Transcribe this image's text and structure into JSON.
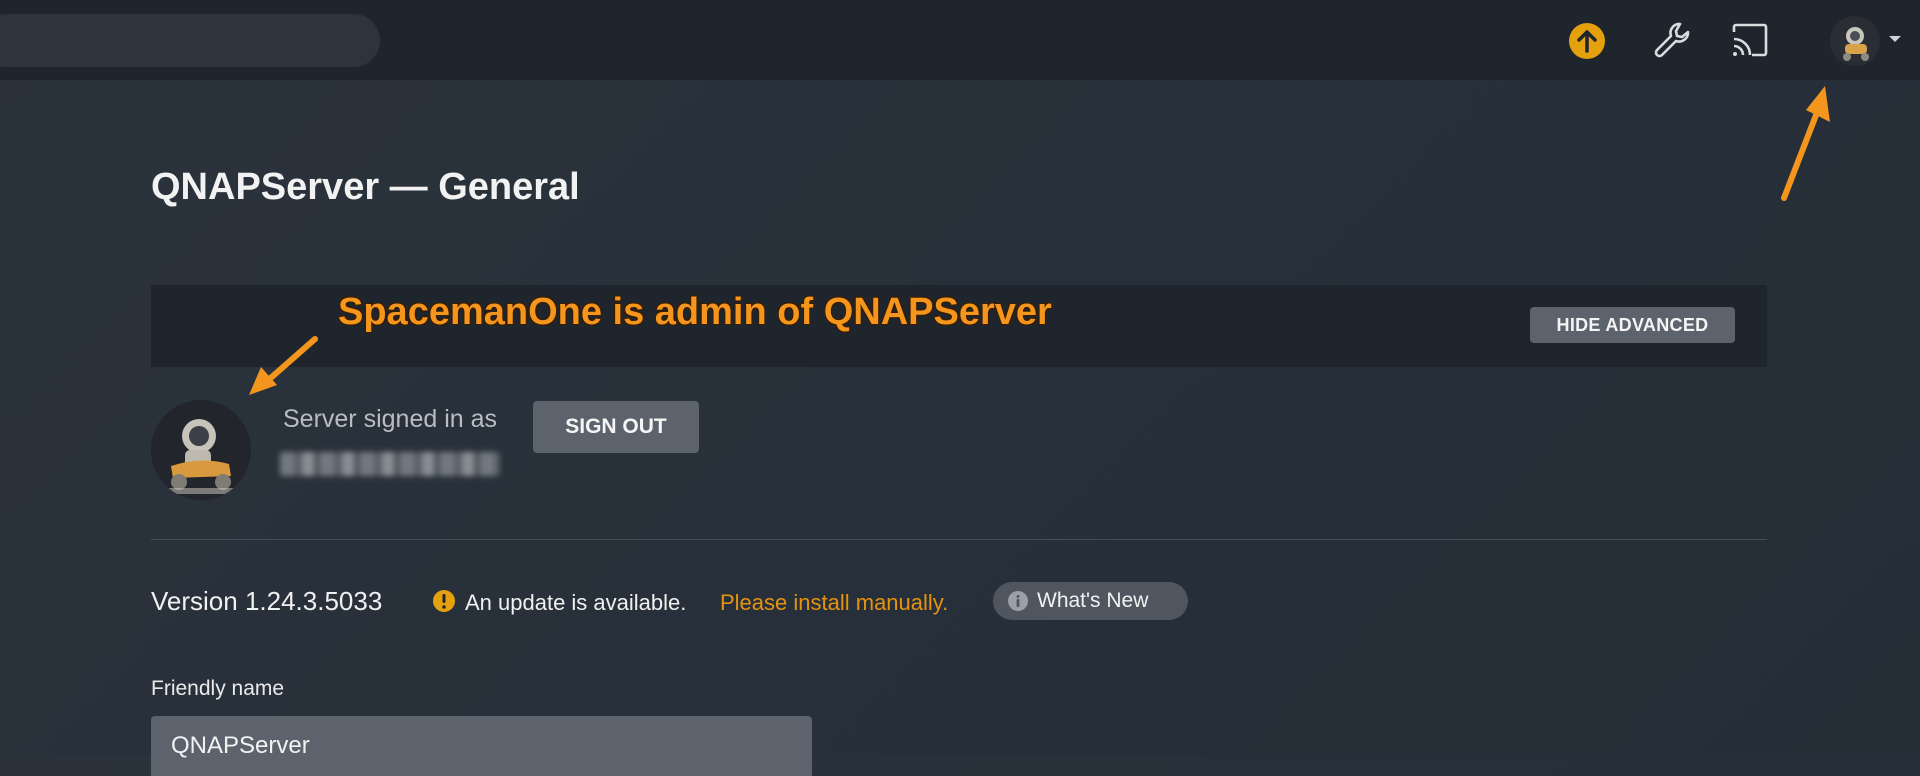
{
  "topbar": {
    "icons": [
      "upload-icon",
      "wrench-icon",
      "cast-icon",
      "avatar",
      "caret-down-icon"
    ]
  },
  "page": {
    "title": "QNAPServer — General"
  },
  "advanced": {
    "toggle_label": "HIDE ADVANCED"
  },
  "annotation": {
    "text": "SpacemanOne is admin of QNAPServer",
    "color": "#f4951d"
  },
  "account": {
    "signed_in_label": "Server signed in as",
    "sign_out_label": "SIGN OUT"
  },
  "version": {
    "label": "Version 1.24.3.5033",
    "update_text": "An update is available.",
    "install_text": "Please install manually.",
    "whats_new_label": "What's New"
  },
  "friendly_name": {
    "label": "Friendly name",
    "value": "QNAPServer"
  },
  "colors": {
    "accent": "#e5a00d",
    "link": "#e5930f",
    "topbar": "#1f252d"
  }
}
